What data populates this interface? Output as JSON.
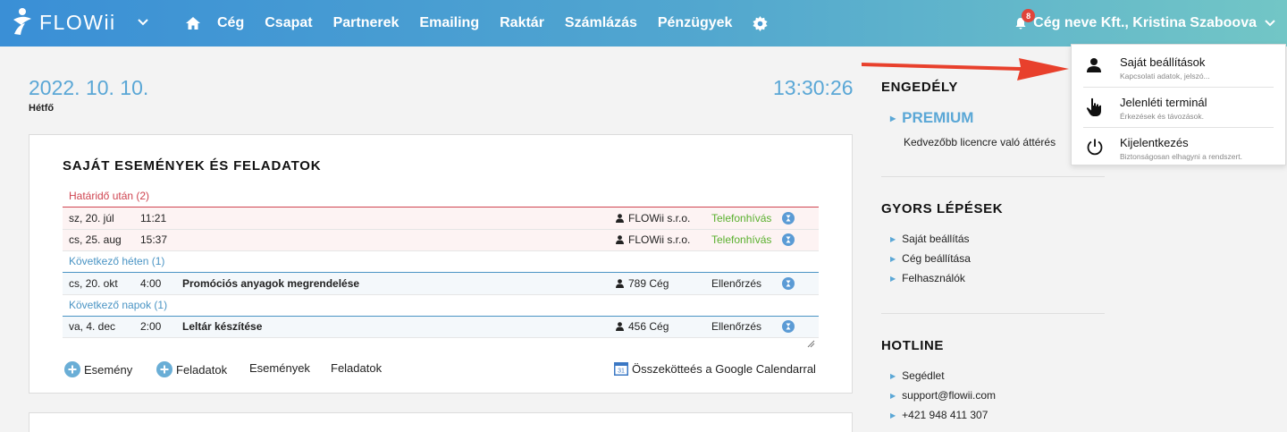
{
  "topbar": {
    "logo_text": "FLOWii",
    "nav": [
      "Cég",
      "Csapat",
      "Partnerek",
      "Emailing",
      "Raktár",
      "Számlázás",
      "Pénzügyek"
    ],
    "notification_count": "8",
    "user": "Cég neve Kft., Kristina Szaboova"
  },
  "main": {
    "date": "2022. 10. 10.",
    "weekday": "Hétfő",
    "time": "13:30:26",
    "card_title": "SAJÁT ESEMÉNYEK ÉS FELADATOK",
    "groups": [
      {
        "label": "Határidő után (2)",
        "rows": [
          {
            "date": "sz, 20. júl",
            "time": "11:21",
            "title": "",
            "partner": "FLOWii s.r.o.",
            "type": "Telefonhívás"
          },
          {
            "date": "cs, 25. aug",
            "time": "15:37",
            "title": "",
            "partner": "FLOWii s.r.o.",
            "type": "Telefonhívás"
          }
        ]
      },
      {
        "label": "Következő héten (1)",
        "rows": [
          {
            "date": "cs, 20. okt",
            "time": "4:00",
            "title": "Promóciós anyagok megrendelése",
            "partner": "789 Cég",
            "type": "Ellenőrzés"
          }
        ]
      },
      {
        "label": "Következő napok (1)",
        "rows": [
          {
            "date": "va, 4. dec",
            "time": "2:00",
            "title": "Leltár készítése",
            "partner": "456 Cég",
            "type": "Ellenőrzés"
          }
        ]
      }
    ],
    "footer": {
      "add_event": "Esemény",
      "add_task": "Feladatok",
      "events": "Események",
      "tasks": "Feladatok",
      "calendar_icon_text": "31",
      "google": "Összekötteés a Google Calendarral"
    }
  },
  "sidebar": {
    "license_title": "ENGEDÉLY",
    "premium": "PREMIUM",
    "premium_sub": "Kedvezőbb licencre való áttérés",
    "quick_title": "GYORS LÉPÉSEK",
    "quick": [
      "Saját beállítás",
      "Cég beállítása",
      "Felhasználók"
    ],
    "hotline_title": "HOTLINE",
    "hotline": [
      "Segédlet",
      "support@flowii.com",
      "+421 948 411 307"
    ]
  },
  "dropdown": [
    {
      "label": "Saját beállítások",
      "sub": "Kapcsolati adatok, jelszó..."
    },
    {
      "label": "Jelenléti terminál",
      "sub": "Érkezések és távozások."
    },
    {
      "label": "Kijelentkezés",
      "sub": "Biztonságosan elhagyni a rendszert."
    }
  ],
  "colors": {
    "accent": "#5aa7d6",
    "overdue": "#cf4450",
    "call": "#5ab02e",
    "arrow": "#e8402c"
  }
}
